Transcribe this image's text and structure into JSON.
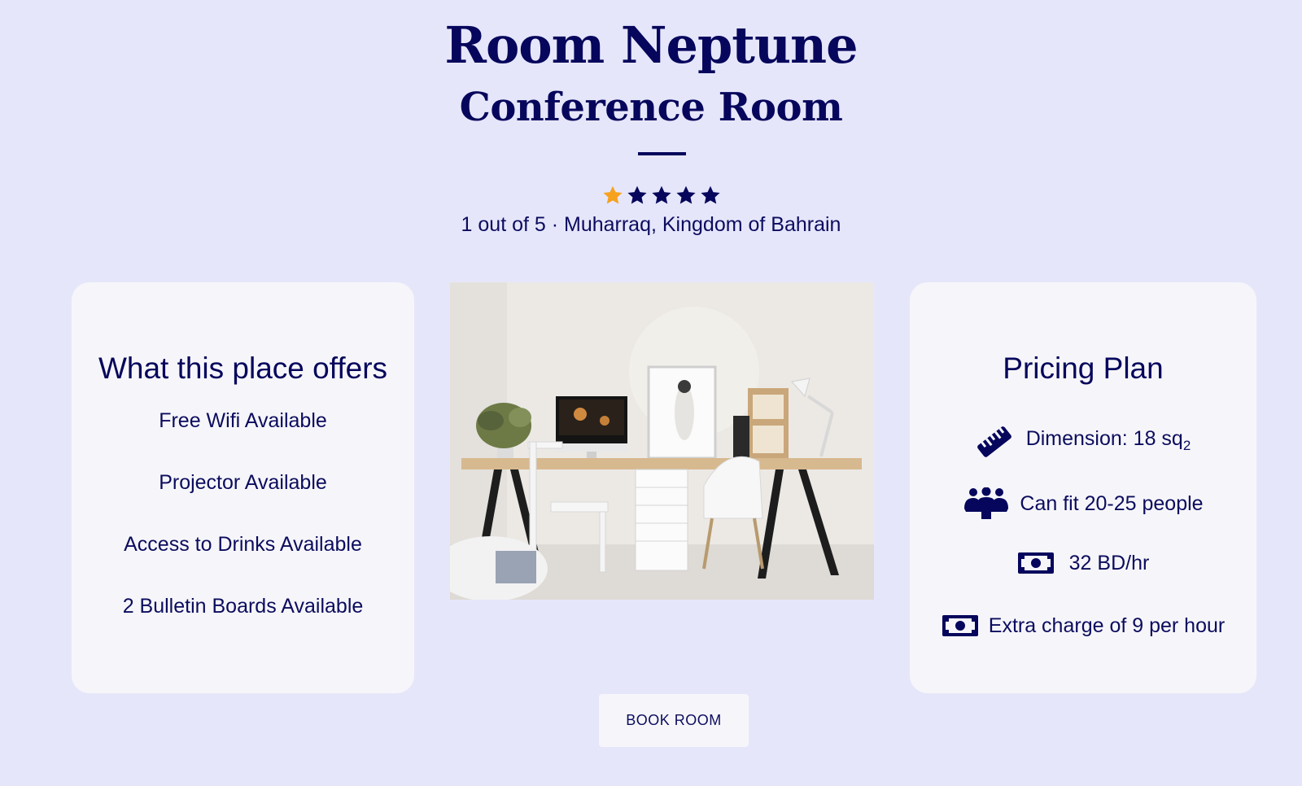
{
  "room": {
    "title": "Room Neptune",
    "type": "Conference Room",
    "rating": 1,
    "rating_max": 5,
    "rating_text": "1 out of 5 · Muharraq, Kingdom of Bahrain"
  },
  "colors": {
    "background": "#e6e6fb",
    "card": "#f6f6fa",
    "primary": "#06065c",
    "star_filled": "#f6a21e",
    "star_empty": "#06065c"
  },
  "offers": {
    "title": "What this place offers",
    "items": [
      "Free Wifi Available",
      "Projector Available",
      "Access to Drinks Available",
      "2 Bulletin Boards Available"
    ]
  },
  "pricing": {
    "title": "Pricing Plan",
    "dimension_text": "Dimension: 18 sq",
    "dimension_sub": "2",
    "capacity": "Can fit 20-25 people",
    "rate": "32 BD/hr",
    "extra": "Extra charge of 9 per hour",
    "icons": [
      "ruler-icon",
      "people-group-icon",
      "money-bill-icon",
      "money-bill-icon"
    ]
  },
  "actions": {
    "book_label": "BOOK ROOM"
  }
}
